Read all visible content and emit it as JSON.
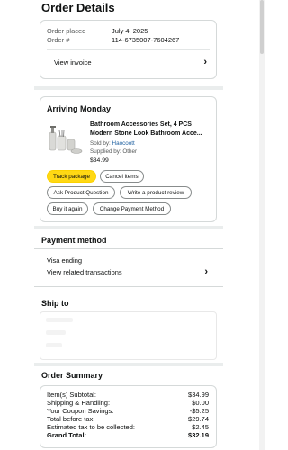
{
  "page_title": "Order Details",
  "order_info": {
    "placed_label": "Order placed",
    "placed_value": "July 4, 2025",
    "number_label": "Order #",
    "number_value": "114-6735007-7604267",
    "view_invoice": "View invoice"
  },
  "shipment": {
    "status": "Arriving Monday",
    "product": {
      "title_line1": "Bathroom Accessories Set, 4 PCS",
      "title_line2": "Modern Stone Look Bathroom Acce...",
      "sold_by_label": "Sold by:",
      "sold_by_value": "Haocoott",
      "supplied_by": "Supplied by: Other",
      "price": "$34.99",
      "image_icon": "bathroom-set-image"
    },
    "buttons": {
      "track": "Track package",
      "cancel": "Cancel items",
      "ask": "Ask Product Question",
      "review": "Write a product review",
      "buy_again": "Buy it again",
      "change_payment": "Change Payment Method"
    }
  },
  "payment": {
    "heading": "Payment method",
    "method": "Visa ending",
    "view_transactions": "View related transactions"
  },
  "ship_to": {
    "heading": "Ship to"
  },
  "summary": {
    "heading": "Order Summary",
    "rows": [
      {
        "label": "Item(s) Subtotal:",
        "value": "$34.99"
      },
      {
        "label": "Shipping & Handling:",
        "value": "$0.00"
      },
      {
        "label": "Your Coupon Savings:",
        "value": "-$5.25"
      },
      {
        "label": "Total before tax:",
        "value": "$29.74"
      },
      {
        "label": "Estimated tax to be collected:",
        "value": "$2.45"
      },
      {
        "label": "Grand Total:",
        "value": "$32.19"
      }
    ]
  },
  "colors": {
    "primary_button": "#ffd814",
    "link": "#2162a1",
    "border": "#d5d9d9",
    "text": "#0f1111"
  }
}
